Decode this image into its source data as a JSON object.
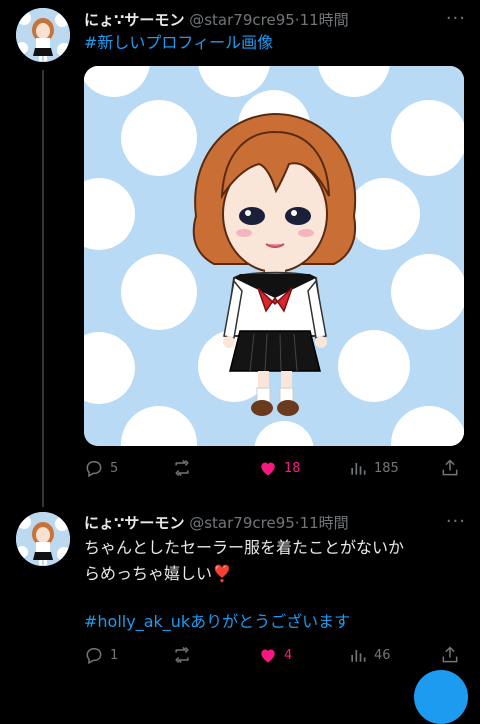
{
  "tweet1": {
    "name": "にょ∵サーモン",
    "handle": "@star79cre95",
    "time": "11時間",
    "hashtag": "#新しいプロフィール画像",
    "replies": "5",
    "likes": "18",
    "views": "185"
  },
  "tweet2": {
    "name": "にょ∵サーモン",
    "handle": "@star79cre95",
    "time": "11時間",
    "text_line1": "ちゃんとしたセーラー服を着たことがないか",
    "text_line2": "らめっちゃ嬉しい",
    "emoji": "❣️",
    "hashtag": "#holly_ak_uk",
    "hashtag_suffix": "ありがとうございます",
    "replies": "1",
    "likes": "4",
    "views": "46"
  },
  "separator": "·",
  "more_label": "···",
  "colors": {
    "accent": "#1d9bf0",
    "like": "#f91880",
    "muted": "#71767b",
    "background": "#000000"
  }
}
